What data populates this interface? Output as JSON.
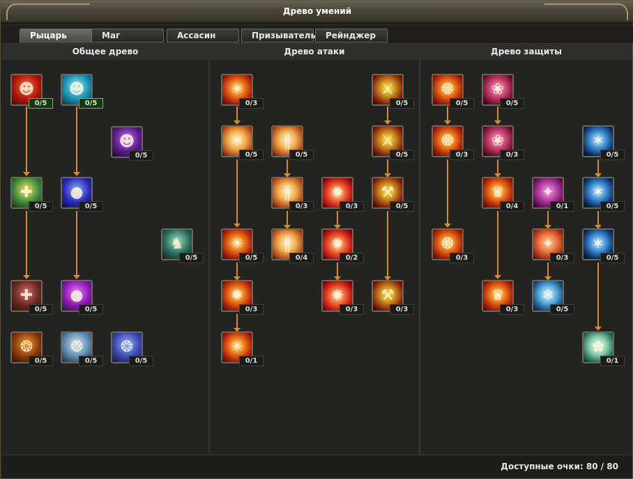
{
  "window": {
    "title": "Древо умений"
  },
  "tabs": [
    {
      "label": "Рыцарь",
      "active": true
    },
    {
      "label": "Маг",
      "active": false
    },
    {
      "label": "Ассасин",
      "active": false
    },
    {
      "label": "Призыватель",
      "active": false
    },
    {
      "label": "Рейнджер",
      "active": false
    }
  ],
  "sections": {
    "general": {
      "title": "Общее древо"
    },
    "attack": {
      "title": "Древо атаки"
    },
    "defense": {
      "title": "Древо защиты"
    }
  },
  "colors": {
    "connector": "#e08a1a",
    "active_badge_border": "#3ed43e",
    "panel_bg": "#232322"
  },
  "skills": [
    {
      "tree": "general",
      "icon": "fire-warrior-icon",
      "rank": "0/5",
      "active": true
    },
    {
      "tree": "general",
      "icon": "water-warrior-icon",
      "rank": "0/5",
      "active": true
    },
    {
      "tree": "general",
      "icon": "shadow-warrior-icon",
      "rank": "0/5"
    },
    {
      "tree": "general",
      "icon": "holy-cross-icon",
      "rank": "0/5"
    },
    {
      "tree": "general",
      "icon": "blue-orb-icon",
      "rank": "0/5"
    },
    {
      "tree": "general",
      "icon": "shadow-figure-icon",
      "rank": "0/5"
    },
    {
      "tree": "general",
      "icon": "red-cross-icon",
      "rank": "0/5"
    },
    {
      "tree": "general",
      "icon": "purple-orb-icon",
      "rank": "0/5"
    },
    {
      "tree": "general",
      "icon": "amber-sigil-icon",
      "rank": "0/5"
    },
    {
      "tree": "general",
      "icon": "ice-sigil-icon",
      "rank": "0/5"
    },
    {
      "tree": "general",
      "icon": "blue-sigil-icon",
      "rank": "0/5"
    },
    {
      "tree": "attack",
      "icon": "flame-emblem-icon",
      "rank": "0/3"
    },
    {
      "tree": "attack",
      "icon": "flaming-sword-icon",
      "rank": "0/5"
    },
    {
      "tree": "attack",
      "icon": "radiant-burst-icon",
      "rank": "0/5"
    },
    {
      "tree": "attack",
      "icon": "sun-pillars-icon",
      "rank": "0/5"
    },
    {
      "tree": "attack",
      "icon": "golden-blade-icon",
      "rank": "0/5"
    },
    {
      "tree": "attack",
      "icon": "light-rays-icon",
      "rank": "0/3"
    },
    {
      "tree": "attack",
      "icon": "star-flare-icon",
      "rank": "0/3"
    },
    {
      "tree": "attack",
      "icon": "hammer-strike-icon",
      "rank": "0/5"
    },
    {
      "tree": "attack",
      "icon": "fire-burst-icon",
      "rank": "0/5"
    },
    {
      "tree": "attack",
      "icon": "light-column-icon",
      "rank": "0/4"
    },
    {
      "tree": "attack",
      "icon": "target-flare-icon",
      "rank": "0/2"
    },
    {
      "tree": "attack",
      "icon": "ember-burst-icon",
      "rank": "0/3"
    },
    {
      "tree": "attack",
      "icon": "nova-icon",
      "rank": "0/3"
    },
    {
      "tree": "attack",
      "icon": "mace-icon",
      "rank": "0/3"
    },
    {
      "tree": "attack",
      "icon": "holy-flame-icon",
      "rank": "0/1"
    },
    {
      "tree": "defense",
      "icon": "shield-emblem-icon",
      "rank": "0/5"
    },
    {
      "tree": "defense",
      "icon": "crimson-aura-icon",
      "rank": "0/5"
    },
    {
      "tree": "defense",
      "icon": "winged-shield-icon",
      "rank": "0/3"
    },
    {
      "tree": "defense",
      "icon": "rose-guard-icon",
      "rank": "0/3"
    },
    {
      "tree": "defense",
      "icon": "frost-branch-icon",
      "rank": "0/5"
    },
    {
      "tree": "defense",
      "icon": "golden-crest-icon",
      "rank": "0/4"
    },
    {
      "tree": "defense",
      "icon": "pink-shards-icon",
      "rank": "0/1"
    },
    {
      "tree": "defense",
      "icon": "frozen-gate-icon",
      "rank": "0/5"
    },
    {
      "tree": "defense",
      "icon": "ornate-shield-icon",
      "rank": "0/3"
    },
    {
      "tree": "defense",
      "icon": "ember-ward-icon",
      "rank": "0/3"
    },
    {
      "tree": "defense",
      "icon": "lightning-tree-icon",
      "rank": "0/5"
    },
    {
      "tree": "defense",
      "icon": "fire-crown-icon",
      "rank": "0/3"
    },
    {
      "tree": "defense",
      "icon": "ice-crystal-icon",
      "rank": "0/5"
    },
    {
      "tree": "defense",
      "icon": "mint-spirit-icon",
      "rank": "0/1"
    }
  ],
  "footer": {
    "points_label": "Доступные очки: 80 / 80"
  }
}
